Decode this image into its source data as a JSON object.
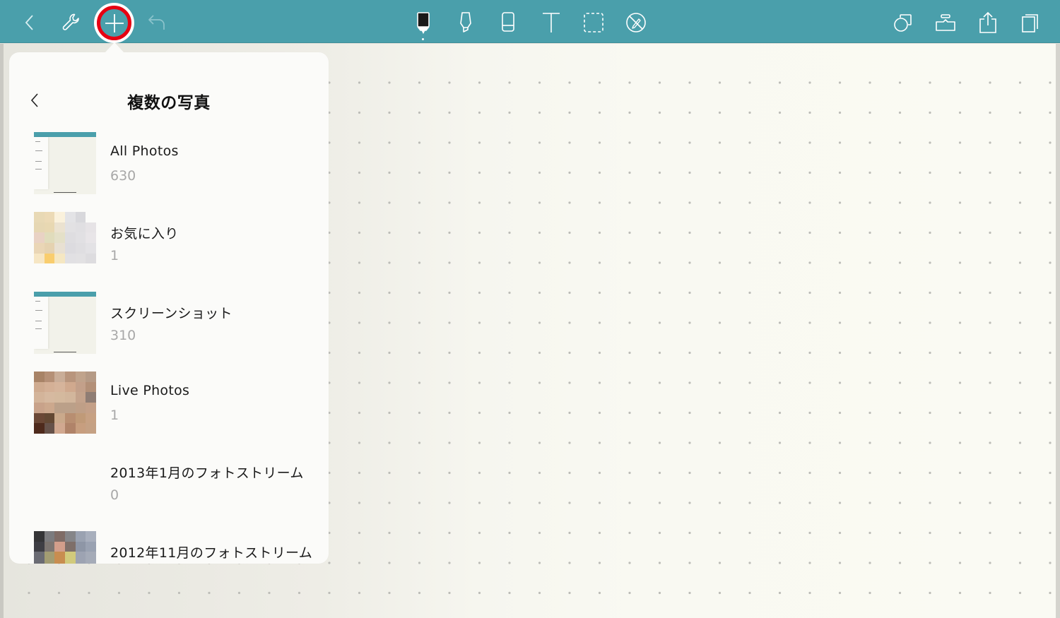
{
  "toolbar": {
    "left_buttons": [
      {
        "name": "back",
        "icon": "chevron-left-icon"
      },
      {
        "name": "tools",
        "icon": "wrench-icon"
      },
      {
        "name": "add",
        "icon": "plus-icon",
        "highlighted": true
      },
      {
        "name": "undo",
        "icon": "undo-icon"
      }
    ],
    "center_tools": [
      {
        "name": "pen",
        "icon": "pen-icon",
        "active": true
      },
      {
        "name": "highlighter",
        "icon": "highlighter-icon"
      },
      {
        "name": "eraser",
        "icon": "eraser-icon"
      },
      {
        "name": "text",
        "icon": "text-icon"
      },
      {
        "name": "lasso",
        "icon": "lasso-select-icon"
      },
      {
        "name": "disable-pen",
        "icon": "pen-disabled-icon"
      }
    ],
    "right_buttons": [
      {
        "name": "shapes",
        "icon": "shapes-icon"
      },
      {
        "name": "stamp",
        "icon": "stamp-icon"
      },
      {
        "name": "share",
        "icon": "share-icon"
      },
      {
        "name": "pages",
        "icon": "pages-icon"
      }
    ],
    "colors": {
      "background": "#4a9fab",
      "highlight_ring": "#e60012"
    }
  },
  "popover": {
    "title": "複数の写真",
    "back_icon": "chevron-left-icon",
    "albums": [
      {
        "name": "All Photos",
        "count": "630",
        "thumb": "screenshot"
      },
      {
        "name": "お気に入り",
        "count": "1",
        "thumb": "mosaic-warm"
      },
      {
        "name": "スクリーンショット",
        "count": "310",
        "thumb": "screenshot"
      },
      {
        "name": "Live Photos",
        "count": "1",
        "thumb": "mosaic-skin"
      },
      {
        "name": "2013年1月のフォトストリーム",
        "count": "0",
        "thumb": "none"
      },
      {
        "name": "2012年11月のフォトストリーム",
        "count": "",
        "thumb": "mosaic-dark"
      }
    ]
  },
  "canvas": {
    "paper": "dot-grid",
    "background": "#fafaf3",
    "dot_color": "#bdbdb8"
  }
}
